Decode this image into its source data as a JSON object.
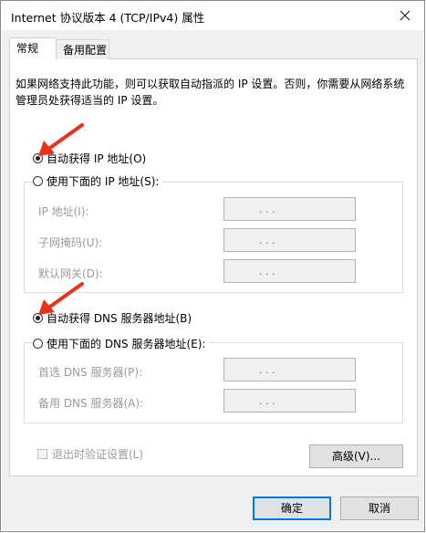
{
  "window": {
    "title": "Internet 协议版本 4 (TCP/IPv4) 属性"
  },
  "tabs": [
    {
      "label": "常规",
      "active": true
    },
    {
      "label": "备用配置",
      "active": false
    }
  ],
  "description": "如果网络支持此功能，则可以获取自动指派的 IP 设置。否则，你需要从网络系统管理员处获得适当的 IP 设置。",
  "ip": {
    "auto_label": "自动获得 IP 地址(O)",
    "auto_selected": true,
    "manual_label": "使用下面的 IP 地址(S):",
    "fields": [
      {
        "label": "IP 地址(I):",
        "value": ". . ."
      },
      {
        "label": "子网掩码(U):",
        "value": ". . ."
      },
      {
        "label": "默认网关(D):",
        "value": ". . ."
      }
    ]
  },
  "dns": {
    "auto_label": "自动获得 DNS 服务器地址(B)",
    "auto_selected": true,
    "manual_label": "使用下面的 DNS 服务器地址(E):",
    "fields": [
      {
        "label": "首选 DNS 服务器(P):",
        "value": ". . ."
      },
      {
        "label": "备用 DNS 服务器(A):",
        "value": ". . ."
      }
    ]
  },
  "validate_label": "退出时验证设置(L)",
  "advanced_label": "高级(V)...",
  "ok_label": "确定",
  "cancel_label": "取消",
  "colors": {
    "accent": "#0078d7",
    "annotation": "#e8321e",
    "panel_bg": "#ffffff",
    "dialog_bg": "#f0f0f0"
  },
  "icons": {
    "close": "close-icon",
    "annotation": "red-arrow-icon"
  }
}
